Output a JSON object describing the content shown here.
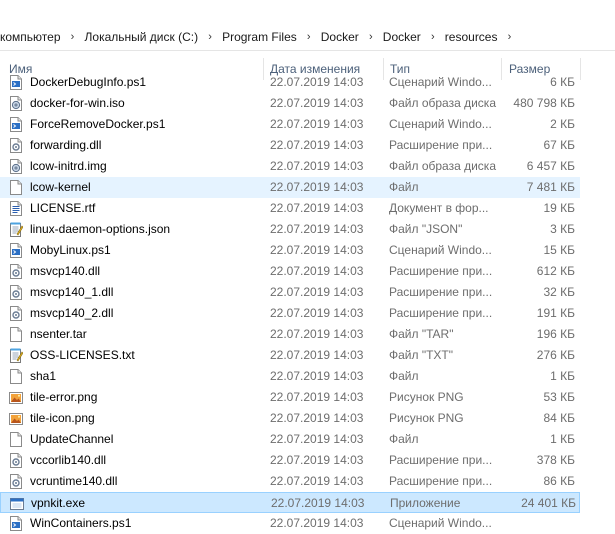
{
  "breadcrumb": {
    "items": [
      "компьютер",
      "Локальный диск (C:)",
      "Program Files",
      "Docker",
      "Docker",
      "resources"
    ]
  },
  "columns": {
    "name": "Имя",
    "date": "Дата изменения",
    "type": "Тип",
    "size": "Размер"
  },
  "files": [
    {
      "name": "DockerDebugInfo.ps1",
      "date": "22.07.2019 14:03",
      "type": "Сценарий Windo...",
      "size": "6 КБ",
      "icon": "script-icon"
    },
    {
      "name": "docker-for-win.iso",
      "date": "22.07.2019 14:03",
      "type": "Файл образа диска",
      "size": "480 798 КБ",
      "icon": "disc-image-icon"
    },
    {
      "name": "ForceRemoveDocker.ps1",
      "date": "22.07.2019 14:03",
      "type": "Сценарий Windo...",
      "size": "2 КБ",
      "icon": "script-icon"
    },
    {
      "name": "forwarding.dll",
      "date": "22.07.2019 14:03",
      "type": "Расширение при...",
      "size": "67 КБ",
      "icon": "dll-icon"
    },
    {
      "name": "lcow-initrd.img",
      "date": "22.07.2019 14:03",
      "type": "Файл образа диска",
      "size": "6 457 КБ",
      "icon": "disc-image-icon"
    },
    {
      "name": "lcow-kernel",
      "date": "22.07.2019 14:03",
      "type": "Файл",
      "size": "7 481 КБ",
      "icon": "file-icon"
    },
    {
      "name": "LICENSE.rtf",
      "date": "22.07.2019 14:03",
      "type": "Документ в фор...",
      "size": "19 КБ",
      "icon": "document-icon"
    },
    {
      "name": "linux-daemon-options.json",
      "date": "22.07.2019 14:03",
      "type": "Файл \"JSON\"",
      "size": "3 КБ",
      "icon": "notepad-icon"
    },
    {
      "name": "MobyLinux.ps1",
      "date": "22.07.2019 14:03",
      "type": "Сценарий Windo...",
      "size": "15 КБ",
      "icon": "script-icon"
    },
    {
      "name": "msvcp140.dll",
      "date": "22.07.2019 14:03",
      "type": "Расширение при...",
      "size": "612 КБ",
      "icon": "dll-icon"
    },
    {
      "name": "msvcp140_1.dll",
      "date": "22.07.2019 14:03",
      "type": "Расширение при...",
      "size": "32 КБ",
      "icon": "dll-icon"
    },
    {
      "name": "msvcp140_2.dll",
      "date": "22.07.2019 14:03",
      "type": "Расширение при...",
      "size": "191 КБ",
      "icon": "dll-icon"
    },
    {
      "name": "nsenter.tar",
      "date": "22.07.2019 14:03",
      "type": "Файл \"TAR\"",
      "size": "196 КБ",
      "icon": "file-icon"
    },
    {
      "name": "OSS-LICENSES.txt",
      "date": "22.07.2019 14:03",
      "type": "Файл \"TXT\"",
      "size": "276 КБ",
      "icon": "notepad-icon"
    },
    {
      "name": "sha1",
      "date": "22.07.2019 14:03",
      "type": "Файл",
      "size": "1 КБ",
      "icon": "file-icon"
    },
    {
      "name": "tile-error.png",
      "date": "22.07.2019 14:03",
      "type": "Рисунок PNG",
      "size": "53 КБ",
      "icon": "image-icon"
    },
    {
      "name": "tile-icon.png",
      "date": "22.07.2019 14:03",
      "type": "Рисунок PNG",
      "size": "84 КБ",
      "icon": "image-icon"
    },
    {
      "name": "UpdateChannel",
      "date": "22.07.2019 14:03",
      "type": "Файл",
      "size": "1 КБ",
      "icon": "file-icon"
    },
    {
      "name": "vccorlib140.dll",
      "date": "22.07.2019 14:03",
      "type": "Расширение при...",
      "size": "378 КБ",
      "icon": "dll-icon"
    },
    {
      "name": "vcruntime140.dll",
      "date": "22.07.2019 14:03",
      "type": "Расширение при...",
      "size": "86 КБ",
      "icon": "dll-icon"
    },
    {
      "name": "vpnkit.exe",
      "date": "22.07.2019 14:03",
      "type": "Приложение",
      "size": "24 401 КБ",
      "icon": "exe-icon"
    },
    {
      "name": "WinContainers.ps1",
      "date": "22.07.2019 14:03",
      "type": "Сценарий Windo...",
      "size": "",
      "icon": "script-icon"
    }
  ],
  "hovered_index": 5,
  "selected_index": 20
}
